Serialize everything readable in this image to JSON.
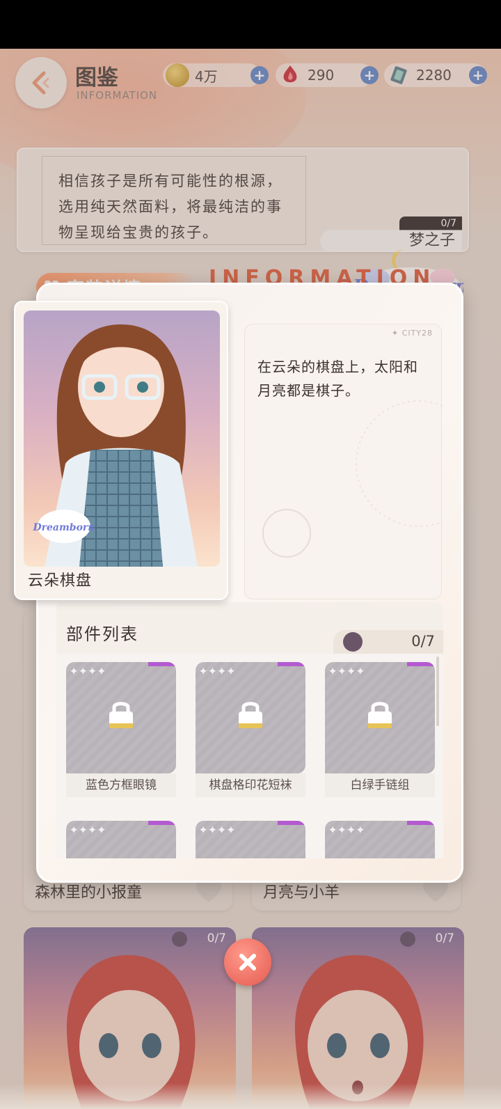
{
  "header": {
    "title": "图鉴",
    "subtitle": "INFORMATION",
    "currencies": [
      {
        "icon": "gold-coin-icon",
        "value": "4万"
      },
      {
        "icon": "red-gem-icon",
        "value": "290"
      },
      {
        "icon": "blue-crystal-icon",
        "value": "2280"
      }
    ]
  },
  "series": {
    "description": "相信孩子是所有可能性的根源，选用纯天然面料，将最纯洁的事物呈现给宝贵的孩子。",
    "progress": "0/7",
    "name": "梦之子",
    "logo_text": "Dreamborn"
  },
  "section": {
    "tab_label": "套装详情",
    "watermark": "INFORMATION"
  },
  "background_cards": {
    "left_label": "森林里的小报童",
    "right_label": "月亮与小羊",
    "bottom_left_count": "0/7",
    "bottom_right_count": "0/7"
  },
  "detail": {
    "outfit_name": "云朵棋盘",
    "description": "在云朵的棋盘上，太阳和月亮都是棋子。",
    "city_tag": "✦ CITY28",
    "parts_title": "部件列表",
    "parts_progress": "0/7",
    "items": [
      {
        "name": "蓝色方框眼镜",
        "stars": "✦✦✦✦",
        "locked": true
      },
      {
        "name": "棋盘格印花短袜",
        "stars": "✦✦✦✦",
        "locked": true
      },
      {
        "name": "白绿手链组",
        "stars": "✦✦✦✦",
        "locked": true
      },
      {
        "name": "",
        "stars": "✦✦✦✦",
        "locked": true
      },
      {
        "name": "",
        "stars": "✦✦✦✦",
        "locked": true
      },
      {
        "name": "",
        "stars": "✦✦✦✦",
        "locked": true
      }
    ]
  },
  "colors": {
    "accent": "#ff9b6a",
    "close_button": "#e45a4e",
    "currency_plus": "#5f86c9"
  }
}
